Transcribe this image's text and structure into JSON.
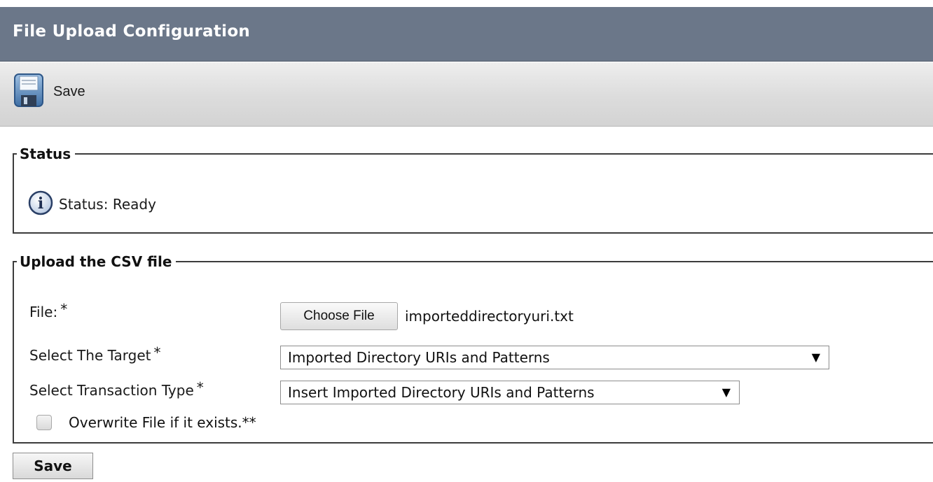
{
  "header": {
    "title": "File Upload Configuration"
  },
  "toolbar": {
    "save_label": "Save",
    "save_icon": "floppy-disk-icon"
  },
  "status_section": {
    "legend": "Status",
    "icon": "info-icon",
    "text": "Status: Ready"
  },
  "upload_section": {
    "legend": "Upload the CSV file",
    "required_marker": "*",
    "file": {
      "label": "File:",
      "button_label": "Choose File",
      "selected_file": "importeddirectoryuri.txt"
    },
    "target": {
      "label": "Select The Target",
      "value": "Imported Directory URIs and Patterns"
    },
    "transaction_type": {
      "label": "Select Transaction Type",
      "value": "Insert Imported Directory URIs and Patterns"
    },
    "overwrite": {
      "label": "Overwrite File if it exists.**",
      "checked": false
    }
  },
  "footer": {
    "save_label": "Save"
  },
  "colors": {
    "title_bar": "#6b7789",
    "toolbar": "#dcdcdc",
    "border": "#3c3c3c"
  }
}
